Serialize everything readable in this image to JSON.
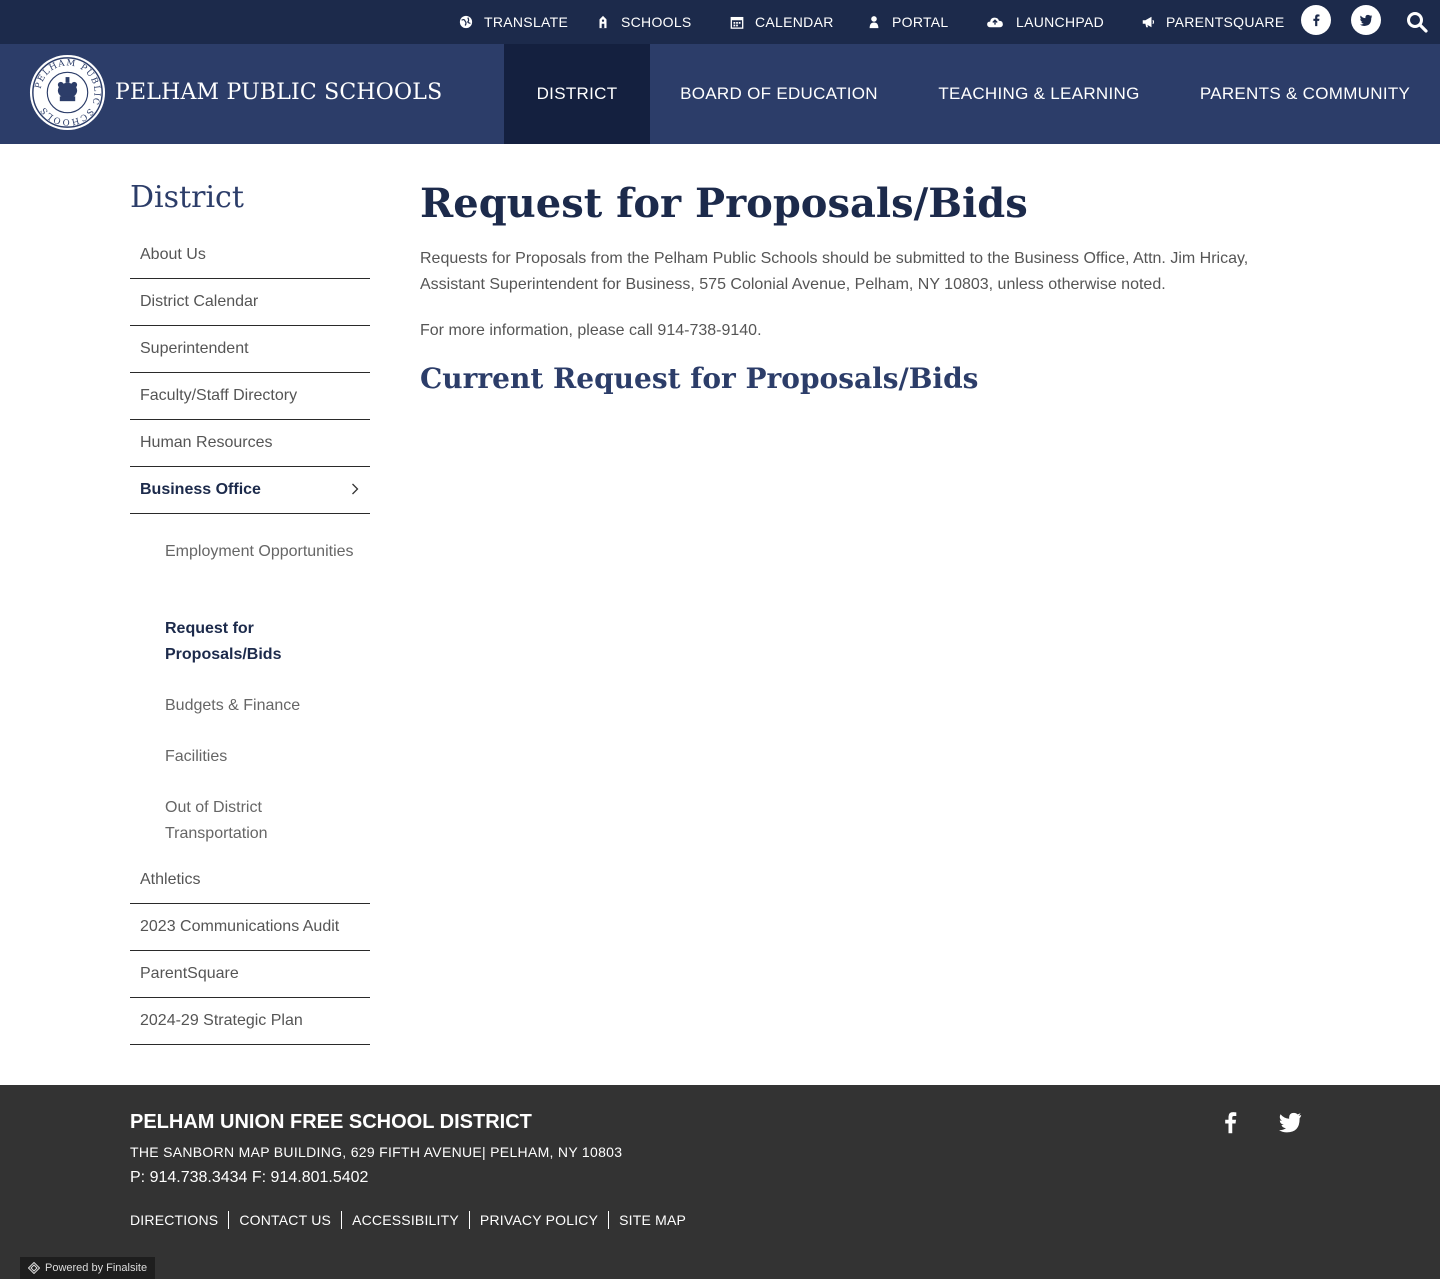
{
  "utility": {
    "translate": "TRANSLATE",
    "schools": "SCHOOLS",
    "calendar": "CALENDAR",
    "portal": "PORTAL",
    "launchpad": "LAUNCHPAD",
    "parentsquare": "PARENTSQUARE",
    "icons": [
      "globe-icon",
      "school-icon",
      "calendar-icon",
      "user-icon",
      "cloud-icon",
      "megaphone-icon",
      "facebook-icon",
      "twitter-icon",
      "search-icon"
    ]
  },
  "header": {
    "site_name": "PELHAM PUBLIC SCHOOLS",
    "seal_text": "PELHAM PUBLIC SCHOOLS",
    "nav": {
      "district": "DISTRICT",
      "board": "BOARD OF EDUCATION",
      "teaching": "TEACHING & LEARNING",
      "parents": "PARENTS & COMMUNITY"
    },
    "active_nav": "DISTRICT"
  },
  "sidebar": {
    "title": "District",
    "items": [
      "About Us",
      "District Calendar",
      "Superintendent",
      "Faculty/Staff Directory",
      "Human Resources",
      "Business Office",
      "Athletics",
      "2023 Communications Audit",
      "ParentSquare",
      "2024-29 Strategic Plan"
    ],
    "sub_items": [
      "Employment Opportunities",
      "Request for Proposals/Bids",
      "Budgets & Finance",
      "Facilities",
      "Out of District Transportation"
    ],
    "active_item": "Business Office",
    "active_sub_item": "Request for Proposals/Bids"
  },
  "main": {
    "title": "Request for Proposals/Bids",
    "paragraph1": "Requests for Proposals from the Pelham Public Schools should be submitted to the Business Office, Attn. Jim Hricay, Assistant Superintendent for Business, 575 Colonial Avenue, Pelham, NY 10803, unless otherwise noted.",
    "paragraph2": "For more information, please call 914-738-9140.",
    "subheading": "Current Request for Proposals/Bids"
  },
  "footer": {
    "title": "PELHAM UNION FREE SCHOOL DISTRICT",
    "address": "THE SANBORN MAP BUILDING, 629 FIFTH AVENUE| PELHAM, NY 10803",
    "phone": "P: 914.738.3434 F: 914.801.5402",
    "links": [
      "DIRECTIONS",
      "CONTACT US",
      "ACCESSIBILITY",
      "PRIVACY POLICY",
      "SITE MAP"
    ],
    "powered_by": "Powered by Finalsite"
  },
  "colors": {
    "utility_bar": "#1c2a4b",
    "header": "#2c3d69",
    "nav_active": "#14203f",
    "heading": "#1c2a4b",
    "footer": "#333333"
  }
}
